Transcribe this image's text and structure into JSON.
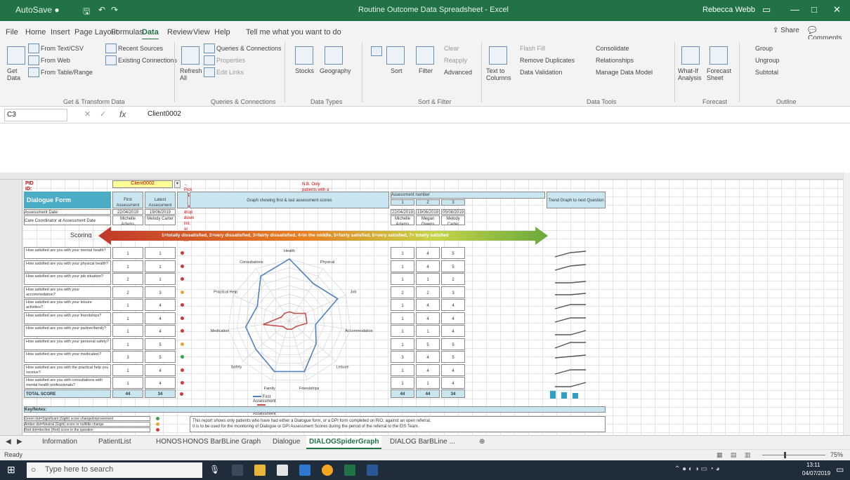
{
  "window": {
    "title": "Routine Outcome Data Spreadsheet - Excel",
    "user": "Rebecca Webb"
  },
  "menu": [
    "File",
    "Home",
    "Insert",
    "Page Layout",
    "Formulas",
    "Data",
    "Review",
    "View",
    "Help",
    "Tell me what you want to do"
  ],
  "menu_active": "Data",
  "share": "Share",
  "comments": "Comments",
  "ribbon": {
    "get_data": "Get Data",
    "from_text": "From Text/CSV",
    "from_web": "From Web",
    "from_table": "From Table/Range",
    "recent_sources": "Recent Sources",
    "existing_connections": "Existing Connections",
    "group1": "Get & Transform Data",
    "refresh_all": "Refresh All",
    "queries_connections": "Queries & Connections",
    "properties": "Properties",
    "edit_links": "Edit Links",
    "group2": "Queries & Connections",
    "stocks": "Stocks",
    "geography": "Geography",
    "group3": "Data Types",
    "sort": "Sort",
    "filter": "Filter",
    "clear": "Clear",
    "reapply": "Reapply",
    "advanced": "Advanced",
    "group4": "Sort & Filter",
    "text_to_columns": "Text to Columns",
    "flash_fill": "Flash Fill",
    "remove_duplicates": "Remove Duplicates",
    "data_validation": "Data Validation",
    "consolidate": "Consolidate",
    "relationships": "Relationships",
    "manage_data_model": "Manage Data Model",
    "group5": "Data Tools",
    "what_if": "What-If Analysis",
    "forecast_sheet": "Forecast Sheet",
    "group6": "Forecast",
    "group_btn": "Group",
    "ungroup": "Ungroup",
    "subtotal": "Subtotal",
    "group7": "Outline"
  },
  "formula_bar": {
    "name_box": "C3",
    "fx": "fx",
    "content": "Client0002"
  },
  "sheet": {
    "pid_label": "PID ID:",
    "pid_value": "Client0002",
    "pid_note": "← Pick PID ID from drop down list, or type in.",
    "pid_note2": "N.B. Only patients with a Dialogue/DPNS form completed can be selected",
    "form_title": "Dialogue Form",
    "first_assessment": "First Assessment",
    "latest_assessment": "Latest Assessment",
    "graph_header": "Graph showing first & last assessment scores",
    "assessments_header": "Assessment number",
    "assessment_nums": [
      "1",
      "2",
      "3"
    ],
    "trend_header": "Trend Graph to next Question",
    "assessment_date": "Assessment Date",
    "assessment_dates": [
      "22/04/2019",
      "19/06/2019"
    ],
    "assessment_dates_right": [
      "22/04/2019",
      "19/06/2019",
      "05/08/2019"
    ],
    "clinicians_label": "Care Coordinator at Assessment Date",
    "clinicians": [
      "Michelle Adams",
      "Melody Carter"
    ],
    "clinicians_right": [
      "Michelle Adams",
      "Megan Owens",
      "Melody Carter"
    ],
    "scoring": "Scoring",
    "scale": "1=totally dissatisfied, 2=very dissatisfied, 3=fairly dissatisfied, 4=in the middle, 5=fairly satisfied, 6=very satisfied, 7= totally satisfied",
    "questions": [
      "How satisfied are you with your mental health?",
      "How satisfied are you with your physical health?",
      "How satisfied are you with your job situation?",
      "How satisfied are you with your accommodation?",
      "How satisfied are you with your leisure activities?",
      "How satisfied are you with your friendships?",
      "How satisfied are you with your partner/family?",
      "How satisfied are you with your personal safety?",
      "How satisfied are you with your medication?",
      "How satisfied are you with the practical help you receive?",
      "How satisfied are you with consultations with mental health professionals?"
    ],
    "first_scores": [
      "1",
      "1",
      "2",
      "2",
      "1",
      "1",
      "1",
      "1",
      "3",
      "1",
      "1"
    ],
    "latest_scores": [
      "1",
      "1",
      "1",
      "3",
      "4",
      "4",
      "4",
      "5",
      "5",
      "4",
      "4"
    ],
    "right_scores": [
      [
        "1",
        "4",
        "5"
      ],
      [
        "1",
        "4",
        "5"
      ],
      [
        "1",
        "1",
        "2"
      ],
      [
        "2",
        "2",
        "3"
      ],
      [
        "1",
        "4",
        "4"
      ],
      [
        "1",
        "4",
        "4"
      ],
      [
        "1",
        "1",
        "4"
      ],
      [
        "1",
        "5",
        "5"
      ],
      [
        "3",
        "4",
        "5"
      ],
      [
        "1",
        "4",
        "4"
      ],
      [
        "1",
        "1",
        "4"
      ]
    ],
    "total_label": "TOTAL SCORE",
    "total_first": "44",
    "total_latest": "34",
    "totals_right": [
      "44",
      "44",
      "34"
    ],
    "key_notes": "Key/Notes:",
    "key_items": [
      "Green dot=Significant (Sight) score change/improvement",
      "Amber dot=Neutral (Sight) score or no/little change",
      "Red dot=decline (Red) score in the question"
    ],
    "note1": "This report shows only patients who have had either a Dialogue form, or a DPI form completed on RiO, against an open referral.",
    "note2": "It is to be used for the monitoring of Dialogue or DPI Assessment Scores during the period of the referral to the EIS Team."
  },
  "spider_labels": [
    "Health",
    "Physical",
    "Job",
    "Accommodation",
    "Leisure",
    "Friendships",
    "Family",
    "Safety",
    "Medication",
    "Practical Help",
    "Consultations"
  ],
  "spider_first": [
    1,
    1,
    2,
    2,
    1,
    1,
    1,
    1,
    3,
    1,
    1
  ],
  "spider_latest": [
    7,
    5,
    6,
    3,
    4,
    6,
    6,
    5,
    5,
    4,
    6
  ],
  "spider_legend": [
    "First Assessment",
    "Latest Assessment"
  ],
  "dot_colors": [
    "#d03a3a",
    "#d03a3a",
    "#d03a3a",
    "#e8a23a",
    "#d03a3a",
    "#d03a3a",
    "#d03a3a",
    "#e8a23a",
    "#3aa34a",
    "#d03a3a",
    "#d03a3a"
  ],
  "tabs": [
    "Information",
    "PatientList",
    "HONOS",
    "HONOS BarBLine Graph",
    "Dialogue",
    "DIALOGSpiderGraph",
    "DIALOG BarBLine ..."
  ],
  "active_tab": "DIALOGSpiderGraph",
  "status": "Ready",
  "zoom": "75%",
  "taskbar": {
    "search": "Type here to search",
    "time": "13:11",
    "date": "04/07/2019"
  },
  "colors": {
    "excel_green": "#217346",
    "first_series": "#4f81bd",
    "latest_series": "#c0504d"
  }
}
